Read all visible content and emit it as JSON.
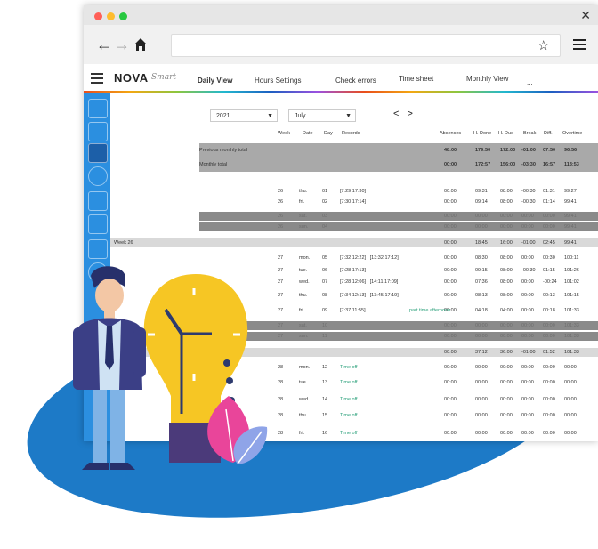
{
  "toolbar": {
    "back_icon": "←",
    "forward_icon": "→",
    "home_icon": "home-icon",
    "star_icon": "☆",
    "close_icon": "✕"
  },
  "app": {
    "logo": "NOVA",
    "logo_sub": "Smart"
  },
  "tabs": [
    {
      "label": "Daily View",
      "active": true
    },
    {
      "label": "Hours Settings",
      "active": false
    },
    {
      "label": "Check errors",
      "active": false
    },
    {
      "label": "Time sheet",
      "active": false
    },
    {
      "label": "Monthly View",
      "active": false
    },
    {
      "label": "...",
      "active": false
    }
  ],
  "filters": {
    "year": "2021",
    "month": "July",
    "prev_next": "< >"
  },
  "columns": [
    "Week",
    "Date",
    "Day",
    "Records",
    "Absences",
    "H. Done",
    "H. Due",
    "Break",
    "Diff.",
    "Overtime"
  ],
  "summary_rows": [
    {
      "label": "Previous monthly total",
      "absences": "48:00",
      "h_done": "179:50",
      "h_due": "172:00",
      "break": "-01:00",
      "diff": "07:50",
      "overtime": "96:56"
    },
    {
      "label": "Monthly total",
      "absences": "00:00",
      "h_done": "172:57",
      "h_due": "156:00",
      "break": "-03:30",
      "diff": "16:57",
      "overtime": "113:53"
    }
  ],
  "rows": [
    {
      "type": "day",
      "week": "26",
      "date": "thu.",
      "day": "01",
      "records": "[7:29 17:30]",
      "absences": "00:00",
      "h_done": "09:31",
      "h_due": "08:00",
      "break": "-00:30",
      "diff": "01:31",
      "overtime": "99:27"
    },
    {
      "type": "day",
      "week": "26",
      "date": "fri.",
      "day": "02",
      "records": "[7:30 17:14]",
      "absences": "00:00",
      "h_done": "09:14",
      "h_due": "08:00",
      "break": "-00:30",
      "diff": "01:14",
      "overtime": "99:41"
    },
    {
      "type": "weekend",
      "week": "26",
      "date": "sat.",
      "day": "03",
      "records": "",
      "absences": "00:00",
      "h_done": "00:00",
      "h_due": "00:00",
      "break": "00:00",
      "diff": "00:00",
      "overtime": "99:41"
    },
    {
      "type": "weekend",
      "week": "26",
      "date": "sun.",
      "day": "04",
      "records": "",
      "absences": "00:00",
      "h_done": "00:00",
      "h_due": "00:00",
      "break": "00:00",
      "diff": "00:00",
      "overtime": "99:41"
    },
    {
      "type": "weektotal",
      "label": "Week 26",
      "absences": "00:00",
      "h_done": "18:45",
      "h_due": "16:00",
      "break": "-01:00",
      "diff": "02:45",
      "overtime": "99:41"
    },
    {
      "type": "day",
      "week": "27",
      "date": "mon.",
      "day": "05",
      "records": "[7:32 12:22] , [13:32 17:12]",
      "absences": "00:00",
      "h_done": "08:30",
      "h_due": "08:00",
      "break": "00:00",
      "diff": "00:30",
      "overtime": "100:11"
    },
    {
      "type": "day",
      "week": "27",
      "date": "tue.",
      "day": "06",
      "records": "[7:28 17:13]",
      "absences": "00:00",
      "h_done": "09:15",
      "h_due": "08:00",
      "break": "-00:30",
      "diff": "01:15",
      "overtime": "101:26"
    },
    {
      "type": "day",
      "week": "27",
      "date": "wed.",
      "day": "07",
      "records": "[7:28 12:06] , [14:11 17:09]",
      "absences": "00:00",
      "h_done": "07:36",
      "h_due": "08:00",
      "break": "00:00",
      "diff": "-00:24",
      "overtime": "101:02"
    },
    {
      "type": "day",
      "week": "27",
      "date": "thu.",
      "day": "08",
      "records": "[7:34 12:13] , [13:45 17:19]",
      "absences": "00:00",
      "h_done": "08:13",
      "h_due": "08:00",
      "break": "00:00",
      "diff": "00:13",
      "overtime": "101:15"
    },
    {
      "type": "day",
      "week": "27",
      "date": "fri.",
      "day": "09",
      "records": "[7:37 11:55]",
      "records_extra": "part time afternoon",
      "absences": "00:00",
      "h_done": "04:18",
      "h_due": "04:00",
      "break": "00:00",
      "diff": "00:18",
      "overtime": "101:33"
    },
    {
      "type": "weekend",
      "week": "27",
      "date": "sat.",
      "day": "10",
      "records": "",
      "absences": "00:00",
      "h_done": "00:00",
      "h_due": "00:00",
      "break": "00:00",
      "diff": "00:00",
      "overtime": "101:33"
    },
    {
      "type": "weekend",
      "week": "27",
      "date": "sun.",
      "day": "11",
      "records": "",
      "absences": "00:00",
      "h_done": "00:00",
      "h_due": "00:00",
      "break": "00:00",
      "diff": "00:00",
      "overtime": "101:33"
    },
    {
      "type": "weektotal",
      "label": "",
      "absences": "00:00",
      "h_done": "37:12",
      "h_due": "36:00",
      "break": "-01:00",
      "diff": "01:52",
      "overtime": "101:33"
    },
    {
      "type": "day",
      "week": "28",
      "date": "mon.",
      "day": "12",
      "records": "Time off",
      "absences": "00:00",
      "h_done": "00:00",
      "h_due": "00:00",
      "break": "00:00",
      "diff": "00:00",
      "overtime": "00:00"
    },
    {
      "type": "day",
      "week": "28",
      "date": "tue.",
      "day": "13",
      "records": "Time off",
      "absences": "00:00",
      "h_done": "00:00",
      "h_due": "00:00",
      "break": "00:00",
      "diff": "00:00",
      "overtime": "00:00"
    },
    {
      "type": "day",
      "week": "28",
      "date": "wed.",
      "day": "14",
      "records": "Time off",
      "absences": "00:00",
      "h_done": "00:00",
      "h_due": "00:00",
      "break": "00:00",
      "diff": "00:00",
      "overtime": "00:00"
    },
    {
      "type": "day",
      "week": "28",
      "date": "thu.",
      "day": "15",
      "records": "Time off",
      "absences": "00:00",
      "h_done": "00:00",
      "h_due": "00:00",
      "break": "00:00",
      "diff": "00:00",
      "overtime": "00:00"
    },
    {
      "type": "day",
      "week": "28",
      "date": "fri.",
      "day": "16",
      "records": "Time off",
      "absences": "00:00",
      "h_done": "00:00",
      "h_due": "00:00",
      "break": "00:00",
      "diff": "00:00",
      "overtime": "00:00"
    }
  ],
  "colors": {
    "sidebar": "#2b8fe0",
    "blob": "#1d7ac7",
    "record_green": "#2aa07a",
    "weekend_row": "#8a8a8a",
    "week_total_row": "#d9d9d9"
  }
}
